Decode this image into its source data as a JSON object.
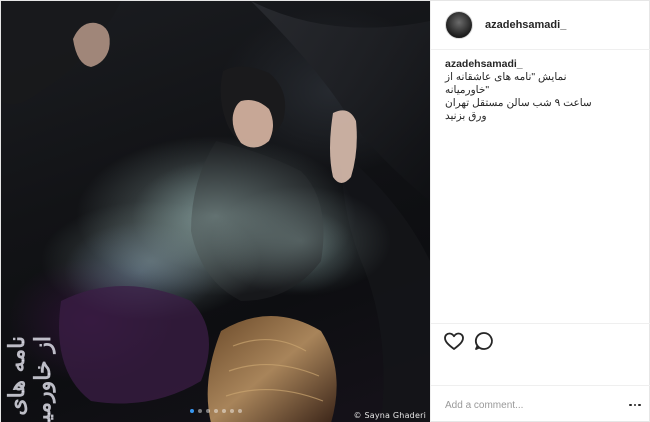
{
  "post": {
    "username": "azadehsamadi_",
    "photo_credit": "© Sayna Ghaderi",
    "title_art": [
      "نامه های عاشقانه",
      "از خاورمیانه"
    ],
    "carousel": {
      "count": 7,
      "active_index": 0
    }
  },
  "caption": {
    "username": "azadehsamadi_",
    "line1": "نمایش \"نامه های عاشقانه از",
    "line2": "\"خاورمیانه",
    "line3": "ساعت ۹ شب سالن مستقل تهران",
    "line4": "ورق بزنید"
  },
  "actions": {
    "like_icon": "heart-icon",
    "comment_icon": "comment-bubble-icon"
  },
  "comment_box": {
    "placeholder": "Add a comment...",
    "more_icon": "more-options-icon"
  },
  "colors": {
    "accent": "#3897f0",
    "text": "#262626",
    "border": "#efefef"
  }
}
